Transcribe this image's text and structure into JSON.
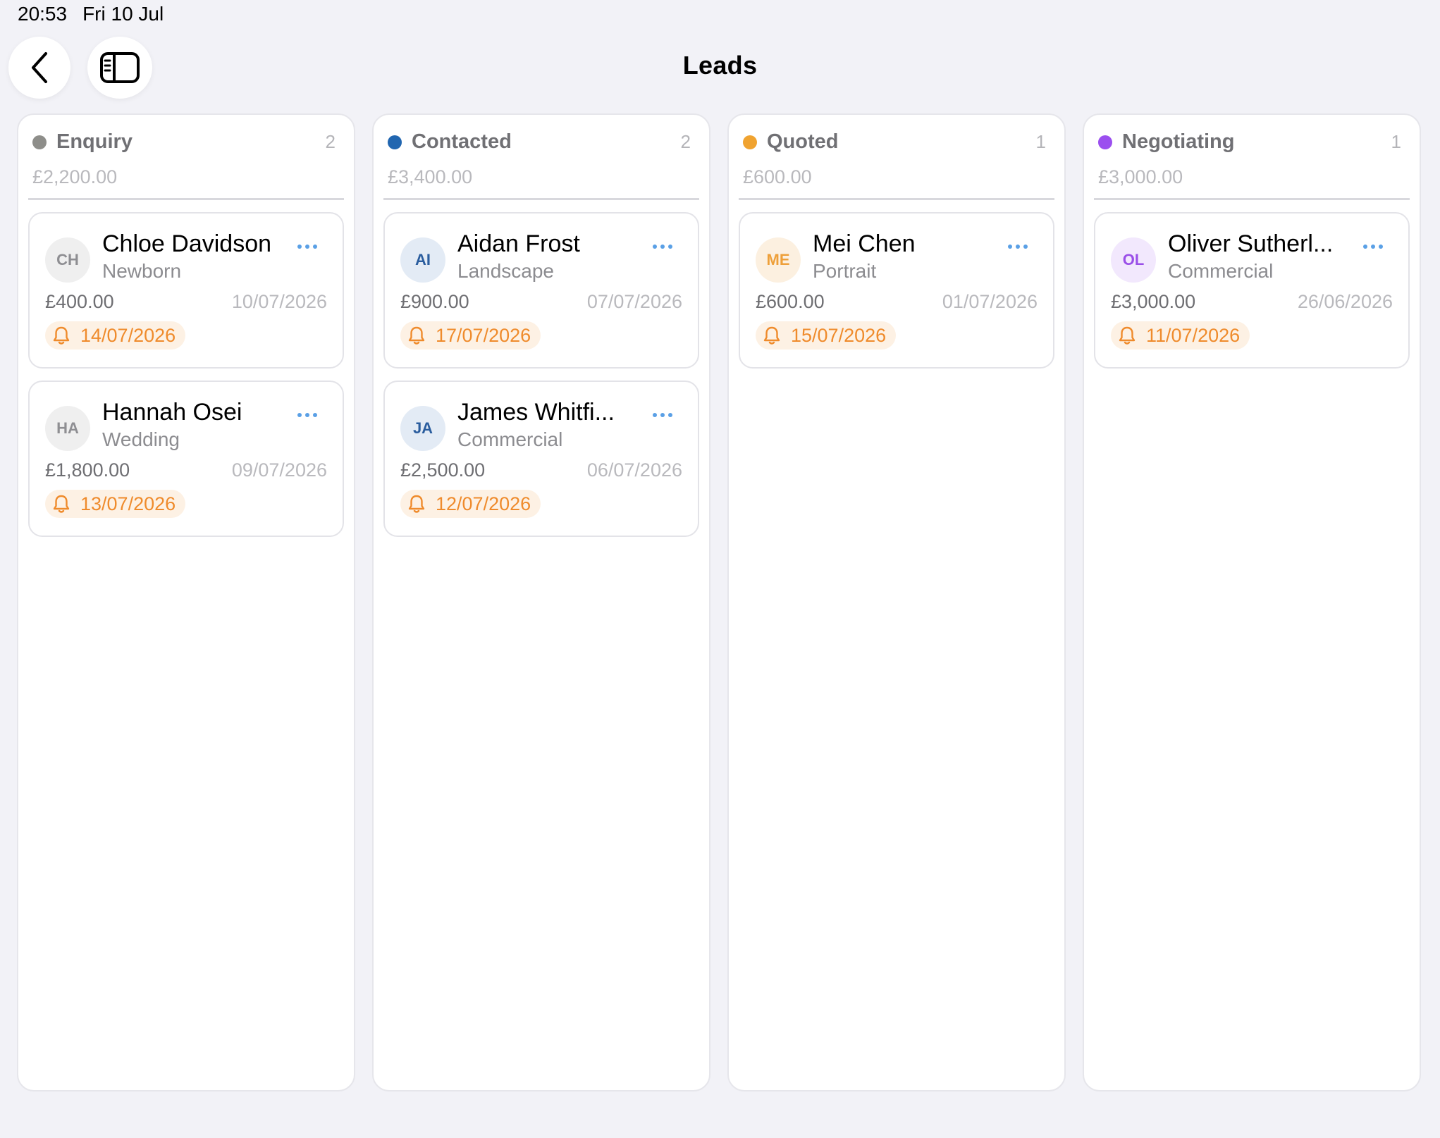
{
  "status_bar": {
    "time": "20:53",
    "date": "Fri 10 Jul"
  },
  "header": {
    "title": "Leads"
  },
  "icons": {
    "back": "chevron-left-icon",
    "sidebar": "sidebar-toggle-icon",
    "more": "ellipsis-icon",
    "reminder": "bell-icon"
  },
  "columns": [
    {
      "title": "Enquiry",
      "count": "2",
      "total": "£2,200.00",
      "color": "#8e8e8a",
      "cards": [
        {
          "initials": "CH",
          "name": "Chloe Davidson",
          "type": "Newborn",
          "value": "£400.00",
          "date": "10/07/2026",
          "reminder": "14/07/2026",
          "avatar_bg": "#efefef",
          "avatar_fg": "#8e8e92"
        },
        {
          "initials": "HA",
          "name": "Hannah Osei",
          "type": "Wedding",
          "value": "£1,800.00",
          "date": "09/07/2026",
          "reminder": "13/07/2026",
          "avatar_bg": "#efefef",
          "avatar_fg": "#8e8e92"
        }
      ]
    },
    {
      "title": "Contacted",
      "count": "2",
      "total": "£3,400.00",
      "color": "#2166b0",
      "cards": [
        {
          "initials": "AI",
          "name": "Aidan Frost",
          "type": "Landscape",
          "value": "£900.00",
          "date": "07/07/2026",
          "reminder": "17/07/2026",
          "avatar_bg": "#e3ebf5",
          "avatar_fg": "#2a5d9e"
        },
        {
          "initials": "JA",
          "name": "James Whitfi...",
          "type": "Commercial",
          "value": "£2,500.00",
          "date": "06/07/2026",
          "reminder": "12/07/2026",
          "avatar_bg": "#e3ebf5",
          "avatar_fg": "#2a5d9e"
        }
      ]
    },
    {
      "title": "Quoted",
      "count": "1",
      "total": "£600.00",
      "color": "#f0a330",
      "cards": [
        {
          "initials": "ME",
          "name": "Mei Chen",
          "type": "Portrait",
          "value": "£600.00",
          "date": "01/07/2026",
          "reminder": "15/07/2026",
          "avatar_bg": "#fcf0e0",
          "avatar_fg": "#eea03a"
        }
      ]
    },
    {
      "title": "Negotiating",
      "count": "1",
      "total": "£3,000.00",
      "color": "#9b4fef",
      "cards": [
        {
          "initials": "OL",
          "name": "Oliver Sutherl...",
          "type": "Commercial",
          "value": "£3,000.00",
          "date": "26/06/2026",
          "reminder": "11/07/2026",
          "avatar_bg": "#f2e8fd",
          "avatar_fg": "#9a4fe8"
        }
      ]
    }
  ]
}
